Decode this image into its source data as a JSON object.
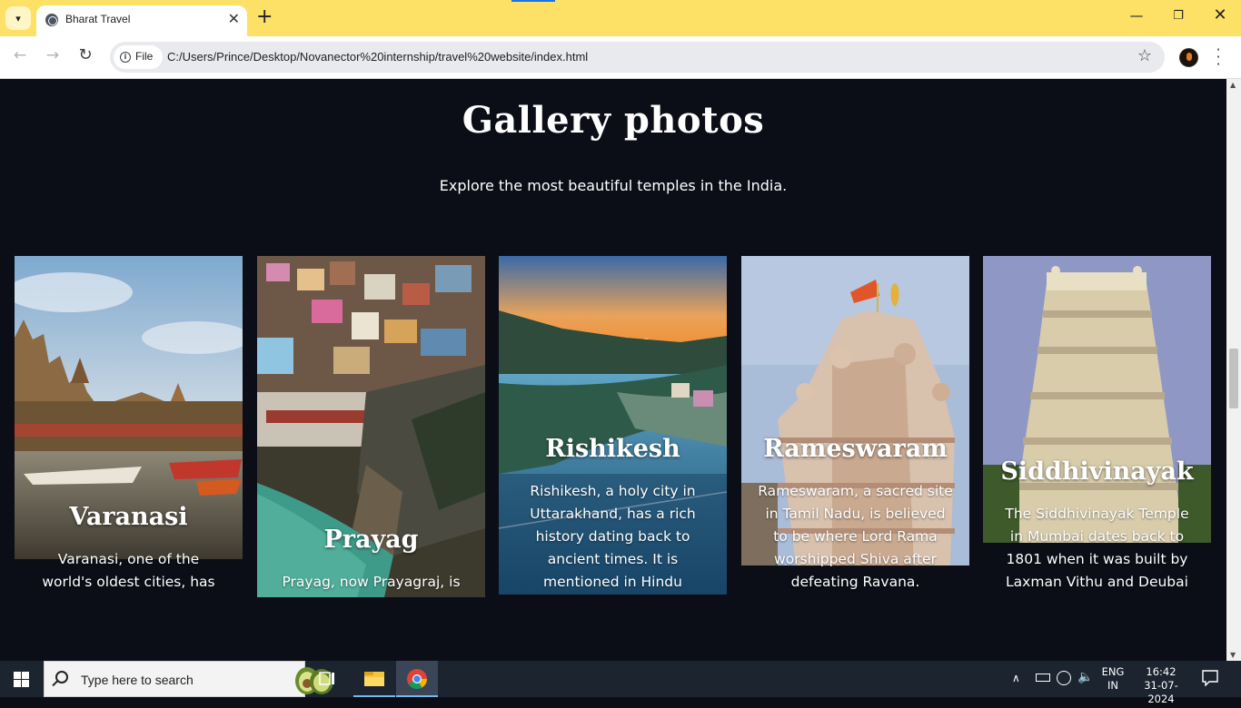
{
  "browser": {
    "tab_title": "Bharat Travel",
    "tab_close": "✕",
    "new_tab": "+",
    "address_chip": "File",
    "url": "C:/Users/Prince/Desktop/Novanector%20internship/travel%20website/index.html",
    "window_controls": {
      "minimize": "—",
      "maximize": "❐",
      "close": "✕"
    }
  },
  "page": {
    "title": "Gallery photos",
    "subtitle": "Explore the most beautiful temples in the India.",
    "cards": [
      {
        "name": "Varanasi",
        "description": "Varanasi, one of the world's oldest cities, has"
      },
      {
        "name": "Prayag",
        "description": "Prayag, now Prayagraj, is"
      },
      {
        "name": "Rishikesh",
        "description": "Rishikesh, a holy city in Uttarakhand, has a rich history dating back to ancient times. It is mentioned in Hindu"
      },
      {
        "name": "Rameswaram",
        "description": "Rameswaram, a sacred site in Tamil Nadu, is believed to be where Lord Rama worshipped Shiva after defeating Ravana."
      },
      {
        "name": "Siddhivinayak",
        "description": "The Siddhivinayak Temple in Mumbai dates back to 1801 when it was built by Laxman Vithu and Deubai"
      }
    ]
  },
  "taskbar": {
    "search_placeholder": "Type here to search",
    "language": "ENG",
    "region": "IN",
    "time": "16:42",
    "date": "31-07-2024"
  },
  "colors": {
    "tabstrip": "#fde066",
    "page_background": "#0b0e17",
    "taskbar": "#1c2430"
  }
}
